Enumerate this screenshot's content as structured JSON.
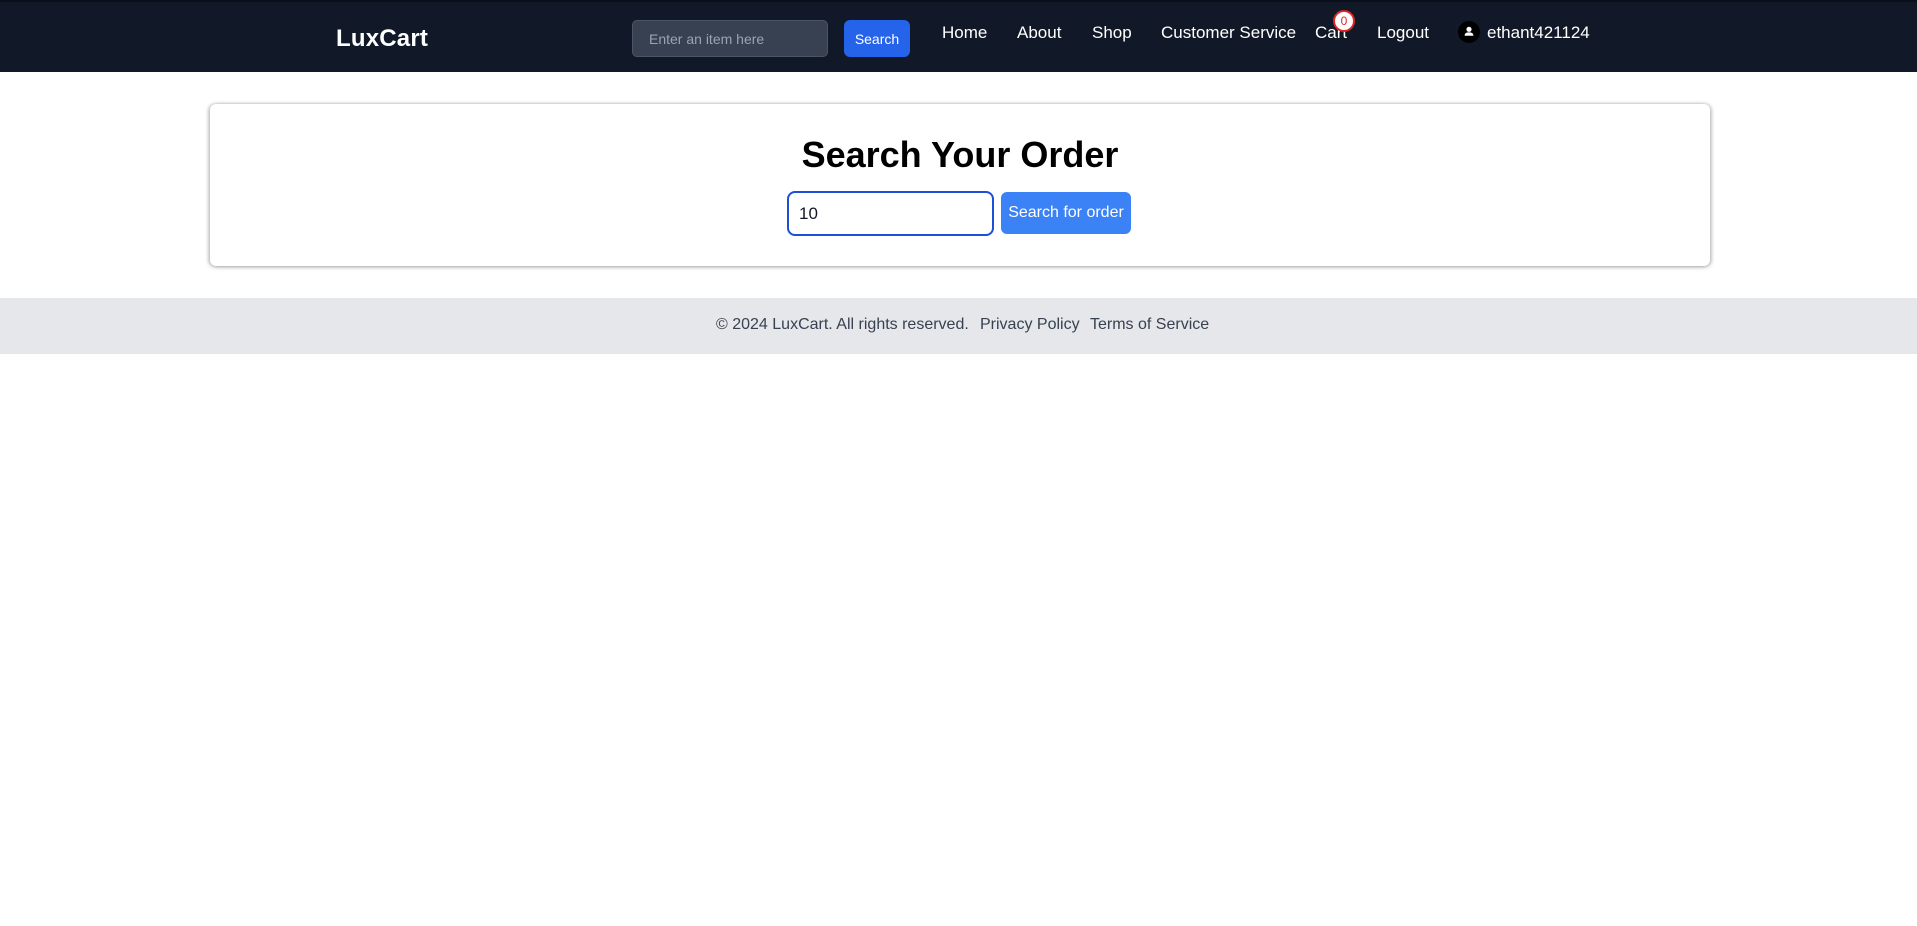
{
  "header": {
    "brand": "LuxCart",
    "search": {
      "placeholder": "Enter an item here",
      "button_label": "Search"
    },
    "nav": {
      "home": "Home",
      "about": "About",
      "shop": "Shop",
      "customer_service": "Customer Service",
      "cart": "Cart",
      "cart_count": "0",
      "logout": "Logout",
      "username": "ethant421124"
    },
    "icons": {
      "user": "user-icon"
    }
  },
  "main": {
    "title": "Search Your Order",
    "order_input_value": "10",
    "search_button_label": "Search for order"
  },
  "footer": {
    "copyright": "© 2024 LuxCart. All rights reserved.",
    "privacy": "Privacy Policy",
    "terms": "Terms of Service"
  },
  "colors": {
    "header_bg": "#111827",
    "primary_button": "#2563eb",
    "order_button": "#3b82f6",
    "badge_border": "#dc2626",
    "footer_bg": "#e5e7eb"
  }
}
